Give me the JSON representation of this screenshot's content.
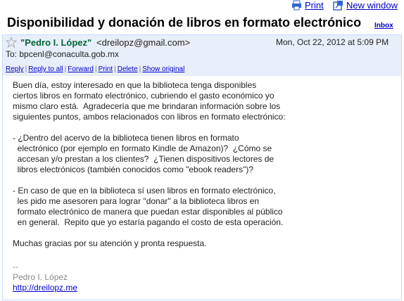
{
  "toolbar": {
    "print_label": "Print",
    "new_window_label": "New window"
  },
  "subject": "Disponibilidad y donación de libros en formato electrónico",
  "label": "Inbox",
  "message": {
    "sender_name": "\"Pedro I. López\"",
    "sender_email": "<dreilopz@gmail.com>",
    "date": "Mon, Oct 22, 2012 at 5:09 PM",
    "to": "To: bpcenl@conaculta.gob.mx",
    "actions": [
      "Reply",
      "Reply to all",
      "Forward",
      "Print",
      "Delete",
      "Show original"
    ],
    "body": "Buen día, estoy interesado en que la biblioteca tenga disponibles\nciertos libros en formato electrónico, cubriendo el gasto económico yo\nmismo claro está.  Agradecería que me brindaran información sobre los\nsiguientes puntos, ambos relacionados con libros en formato electrónico:\n\n- ¿Dentro del acervo de la biblioteca tienen libros en formato\n  electrónico (por ejemplo en formato Kindle de Amazon)?  ¿Cómo se\n  accesan y/o prestan a los clientes?  ¿Tienen dispositivos lectores de\n  libros electrónicos (también conocidos como \"ebook readers\")?\n\n- En caso de que en la biblioteca sí usen libros en formato electrónico,\n  les pido me asesoren para lograr \"donar\" a la biblioteca libros en\n  formato electrónico de manera que puedan estar disponibles al público\n  en general.  Repito que yo estaría pagando el costo de esta operación.\n\nMuchas gracias por su atención y pronta respuesta.",
    "signature": {
      "dash": "--",
      "name": "Pedro I. López",
      "url": "http://dreilopz.me"
    }
  },
  "colors": {
    "header_bg": "#e8eefa",
    "border": "#c3d9ff",
    "link": "#0000cc",
    "sender": "#006633"
  }
}
